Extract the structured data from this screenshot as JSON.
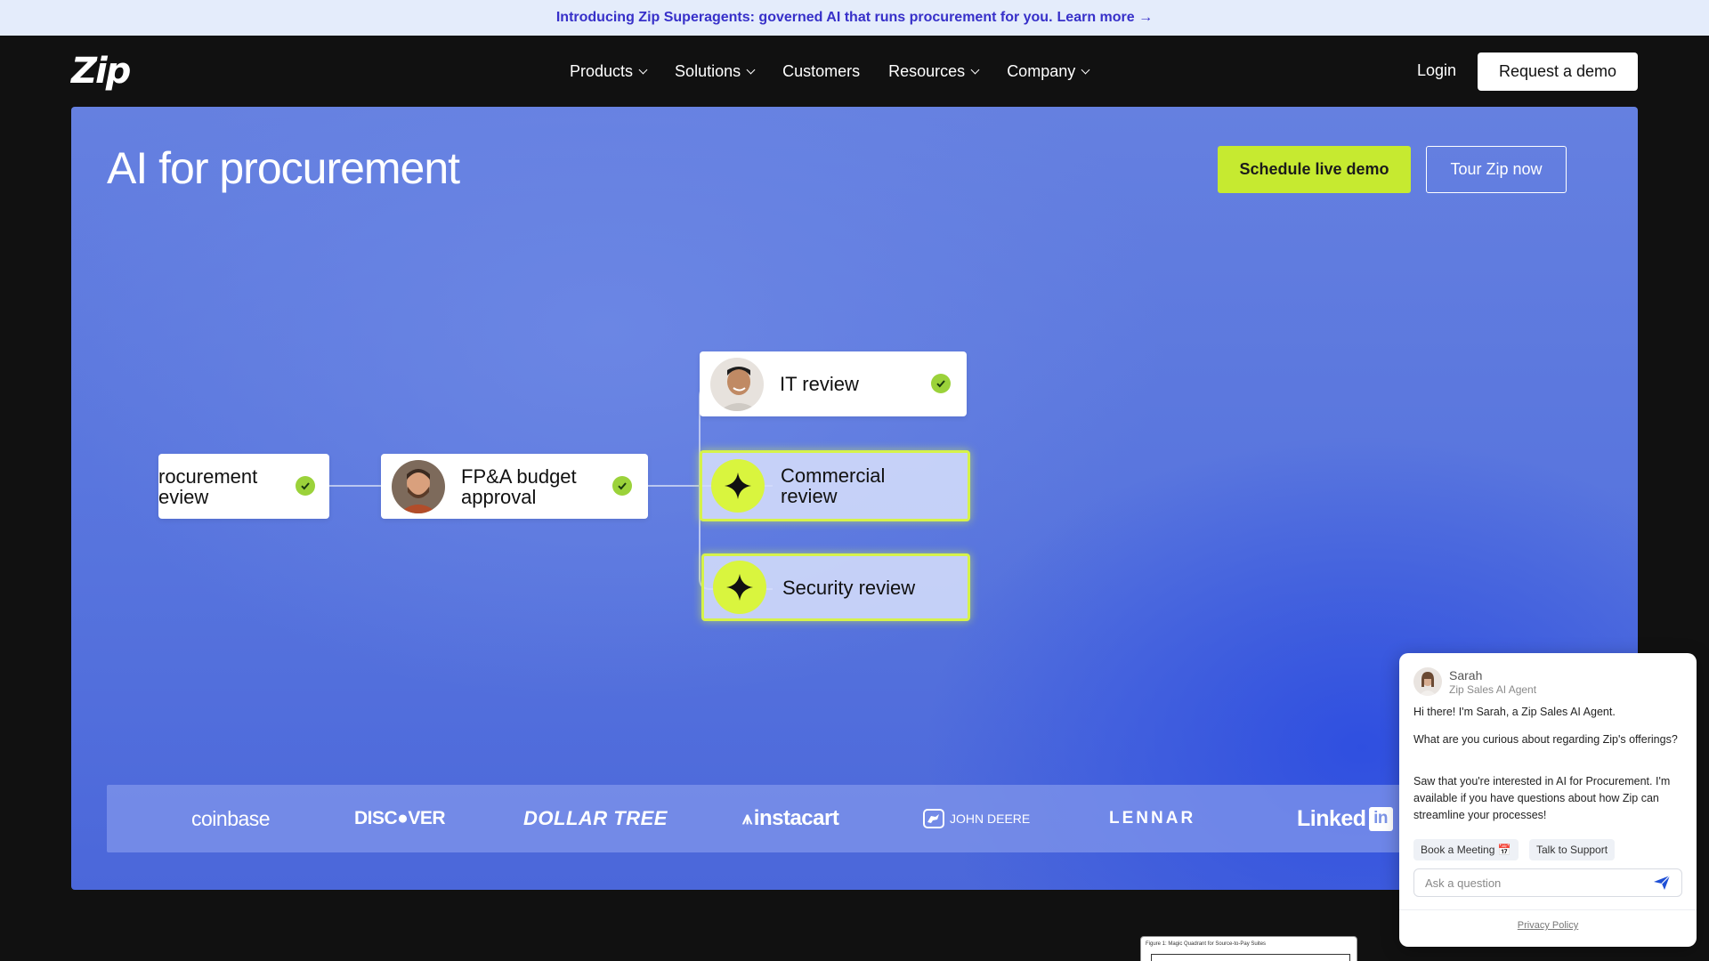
{
  "announcement": {
    "text": "Introducing Zip Superagents: governed AI that runs procurement for you.",
    "link": "Learn more →"
  },
  "nav": {
    "logo": "Zip",
    "items": [
      {
        "label": "Products",
        "has_dropdown": true
      },
      {
        "label": "Solutions",
        "has_dropdown": true
      },
      {
        "label": "Customers",
        "has_dropdown": false
      },
      {
        "label": "Resources",
        "has_dropdown": true
      },
      {
        "label": "Company",
        "has_dropdown": true
      }
    ],
    "login": "Login",
    "request_demo": "Request a demo"
  },
  "hero": {
    "title": "AI for procurement",
    "schedule_button": "Schedule live demo",
    "tour_button": "Tour Zip now",
    "workflow": {
      "procurement_review": "rocurement\neview",
      "fpa_budget": "FP&A budget\napproval",
      "it_review": "IT review",
      "commercial_review": "Commercial\nreview",
      "security_review": "Security review"
    }
  },
  "logos": {
    "coinbase": "coinbase",
    "discover": "DISC●VER",
    "dollar_tree": "DOLLAR TREE",
    "instacart": "instacart",
    "john_deere": "JOHN DEERE",
    "lennar": "LENNAR",
    "linkedin": "Linked",
    "linkedin_in": "in"
  },
  "chat": {
    "agent_name": "Sarah",
    "agent_role": "Zip Sales AI Agent",
    "msg1": "Hi there! I'm Sarah, a Zip Sales AI Agent.",
    "msg2": "What are you curious about regarding Zip's offerings?",
    "msg3": "Saw that you're interested in AI for Procurement. I'm available if you have questions about how Zip can streamline your processes!",
    "chip_meeting": "Book a Meeting 📅",
    "chip_support": "Talk to Support",
    "input_placeholder": "Ask a question",
    "privacy": "Privacy Policy"
  },
  "doc_thumb": {
    "caption": "Figure 1: Magic Quadrant for Source-to-Pay Suites"
  },
  "colors": {
    "accent_lime": "#c6ea30",
    "announce_bg": "#e4ecfb",
    "announce_text": "#3730c9",
    "hero_blue": "#5673dd"
  }
}
